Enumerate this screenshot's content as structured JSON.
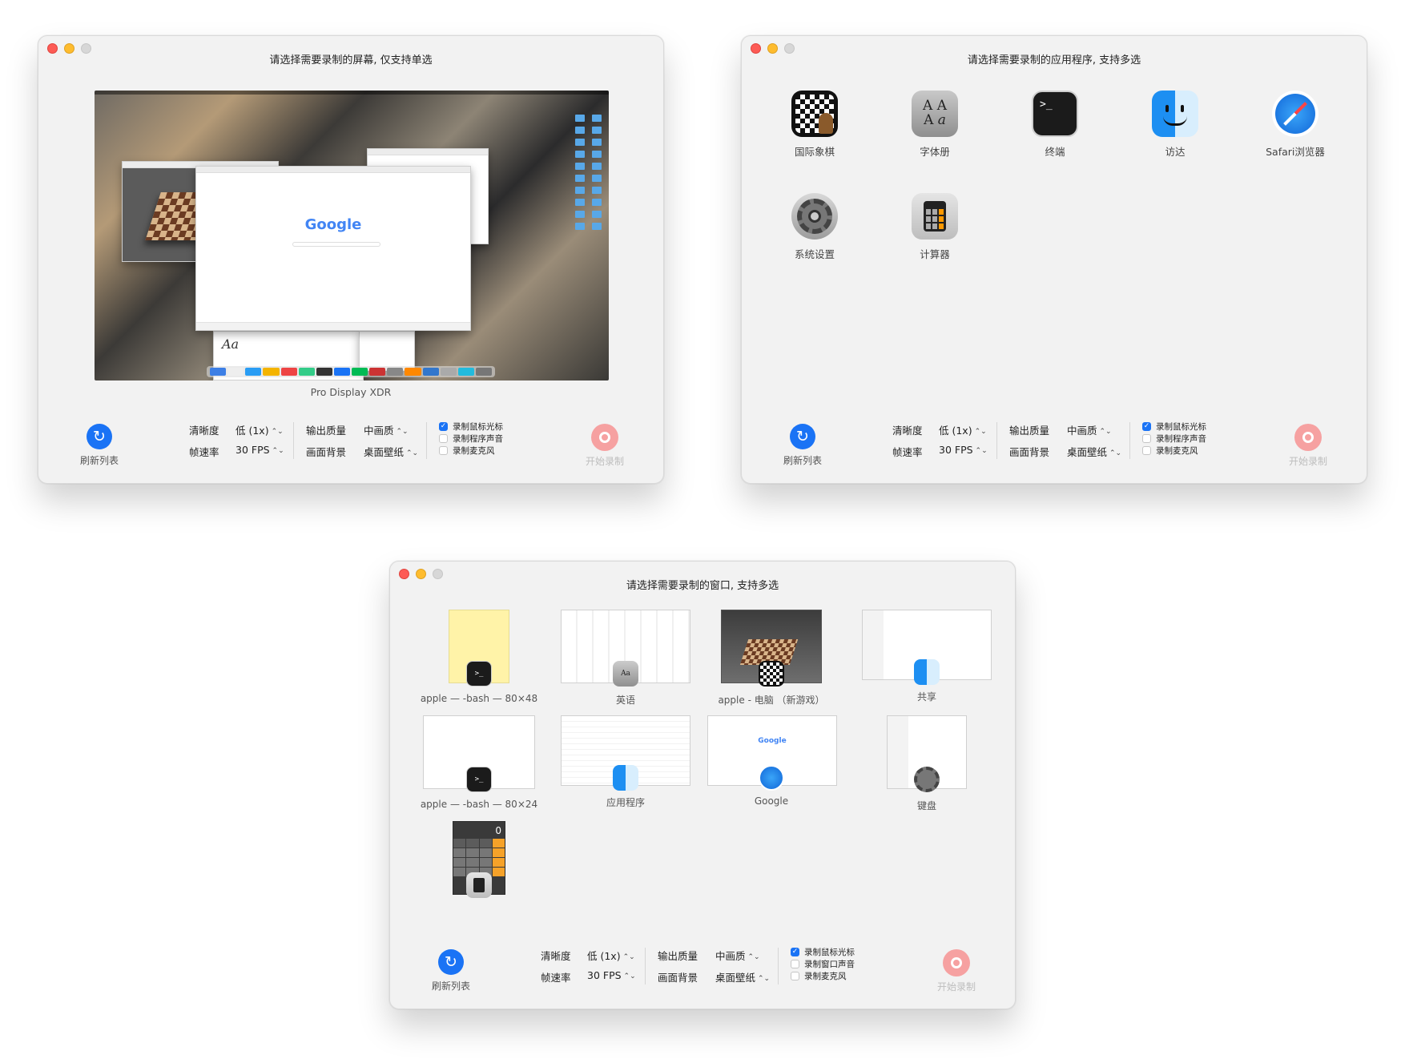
{
  "windows": {
    "screen": {
      "title": "请选择需要录制的屏幕, 仅支持单选",
      "screen_caption": "Pro Display XDR",
      "google_logo": "Google"
    },
    "apps": {
      "title": "请选择需要录制的应用程序, 支持多选",
      "items": [
        {
          "label": "国际象棋",
          "icon": "chess-icon"
        },
        {
          "label": "字体册",
          "icon": "font-book-icon"
        },
        {
          "label": "终端",
          "icon": "terminal-icon"
        },
        {
          "label": "访达",
          "icon": "finder-icon"
        },
        {
          "label": "Safari浏览器",
          "icon": "safari-icon"
        },
        {
          "label": "系统设置",
          "icon": "system-settings-icon"
        },
        {
          "label": "计算器",
          "icon": "calculator-icon"
        }
      ]
    },
    "windows": {
      "title": "请选择需要录制的窗口, 支持多选",
      "items": [
        {
          "label": "apple — -bash — 80×48",
          "badge": "terminal-icon"
        },
        {
          "label": "英语",
          "badge": "font-book-icon"
        },
        {
          "label": "apple - 电脑 （新游戏）",
          "badge": "chess-icon"
        },
        {
          "label": "共享",
          "badge": "finder-icon"
        },
        {
          "label": "apple — -bash — 80×24",
          "badge": "terminal-icon"
        },
        {
          "label": "应用程序",
          "badge": "finder-icon"
        },
        {
          "label": "Google",
          "badge": "safari-icon"
        },
        {
          "label": "键盘",
          "badge": "system-settings-icon"
        },
        {
          "label": "",
          "badge": "calculator-icon"
        }
      ],
      "calculator_display": "0",
      "thumb_google": "Google"
    }
  },
  "toolbar": {
    "refresh_label": "刷新列表",
    "clarity_label": "清晰度",
    "clarity_value": "低 (1x)",
    "fps_label": "帧速率",
    "fps_value": "30 FPS",
    "output_quality_label": "输出质量",
    "output_quality_value": "中画质",
    "background_label": "画面背景",
    "background_value": "桌面壁纸",
    "cb_cursor": "录制鼠标光标",
    "cb_app_audio": "录制程序声音",
    "cb_window_audio": "录制窗口声音",
    "cb_mic": "录制麦克风",
    "start_label": "开始录制",
    "cursor_checked": true,
    "audio_checked": false,
    "mic_checked": false
  },
  "colors": {
    "accent": "#1a73f5",
    "record": "#f6a1a1",
    "window_bg": "#f2f2f2"
  }
}
